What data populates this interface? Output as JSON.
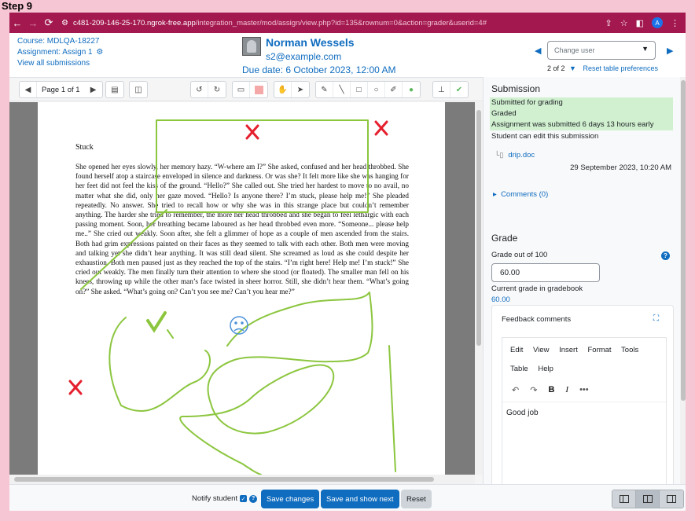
{
  "step_label": "Step 9",
  "browser": {
    "url_host": "c481-209-146-25-170.ngrok-free.app",
    "url_path": "/integration_master/mod/assign/view.php?id=135&rownum=0&action=grader&userid=4#",
    "profile_initial": "A"
  },
  "header": {
    "course": "Course: MDLQA-18227",
    "assignment": "Assignment: Assign 1",
    "view_all": "View all submissions",
    "user_name": "Norman Wessels",
    "user_email": "s2@example.com",
    "due_date": "Due date: 6 October 2023, 12:00 AM",
    "change_user_placeholder": "Change user",
    "count": "2 of 2",
    "reset_prefs": "Reset table preferences"
  },
  "pdf": {
    "page_label": "Page 1 of 1",
    "doc_title": "Stuck",
    "doc_text": "She opened her eyes slowly, her memory hazy. “W-where am I?” She asked, confused and her head throbbed. She found herself atop a staircase enveloped in silence and darkness. Or was she? It felt more like she was hanging for her feet did not feel the kiss of the ground. “Hello?” She called out. She tried her hardest to move to no avail, no matter what she did, only her gaze moved. “Hello? Is anyone there? I’m stuck, please help me!” She pleaded repeatedly. No answer. She tried to recall how or why she was in this strange place but couldn’t remember anything. The harder she tried to remember, the more her head throbbed and she began to feel lethargic with each passing moment. Soon, her breathing became laboured as her head throbbed even more. “Someone... please help me..” She cried out weakly. Soon after, she felt a glimmer of hope as a couple of men ascended from the stairs. Both had grim expressions painted on their faces as they seemed to talk with each other. Both men were moving and talking yet she didn’t hear anything. It was still dead silent. She screamed as loud as she could despite her exhaustion. Both men paused just as they reached the top of the stairs. “I’m right here! Help me! I’m stuck!” She cried out weakly. The men finally turn their attention to where she stood (or floated). The smaller man fell on his knees, throwing up while the other man’s face twisted in sheer horror. Still, she didn’t hear them. “What’s going on?” She asked. “What’s going on? Can’t you see me? Can’t you hear me?”",
    "annotation_color": "#8cc63f",
    "cross_color": "#e5202e"
  },
  "submission": {
    "title": "Submission",
    "status_lines": [
      "Submitted for grading",
      "Graded",
      "Assignment was submitted 6 days 13 hours early"
    ],
    "edit_note": "Student can edit this submission",
    "file_name": "drip.doc",
    "file_date": "29 September 2023, 10:20 AM",
    "comments": "Comments (0)"
  },
  "grade": {
    "title": "Grade",
    "label": "Grade out of 100",
    "value": "60.00",
    "current_label": "Current grade in gradebook",
    "current_value": "60.00",
    "feedback_title": "Feedback comments",
    "menu": [
      "Edit",
      "View",
      "Insert",
      "Format",
      "Tools",
      "Table",
      "Help"
    ],
    "feedback_text": "Good job"
  },
  "footer": {
    "notify": "Notify student",
    "save": "Save changes",
    "save_next": "Save and show next",
    "reset": "Reset"
  }
}
